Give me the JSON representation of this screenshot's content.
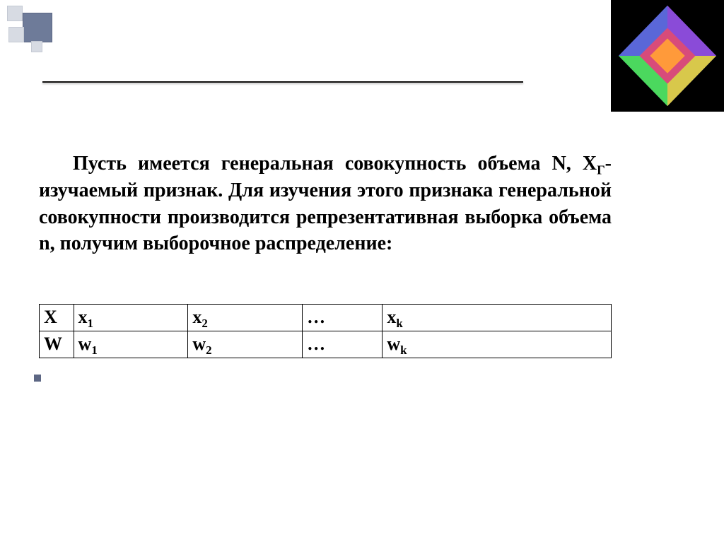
{
  "paragraph": {
    "t1": "Пусть имеется генеральная совокупность объема N, X",
    "sub1": "Г",
    "t2": "- изучаемый признак. Для изучения этого признака генеральной совокупности производится репрезентативная  выборка объема n, получим выборочное распределение:"
  },
  "table": {
    "row1": {
      "c1": "X",
      "c2_base": "x",
      "c2_sub": "1",
      "c3_base": "x",
      "c3_sub": "2",
      "c4": "…",
      "c5_base": "x",
      "c5_sub": "k"
    },
    "row2": {
      "c1": "W",
      "c2_base": "w",
      "c2_sub": "1",
      "c3_base": "w",
      "c3_sub": "2",
      "c4": " …",
      "c5_base": "w",
      "c5_sub": "k"
    }
  }
}
